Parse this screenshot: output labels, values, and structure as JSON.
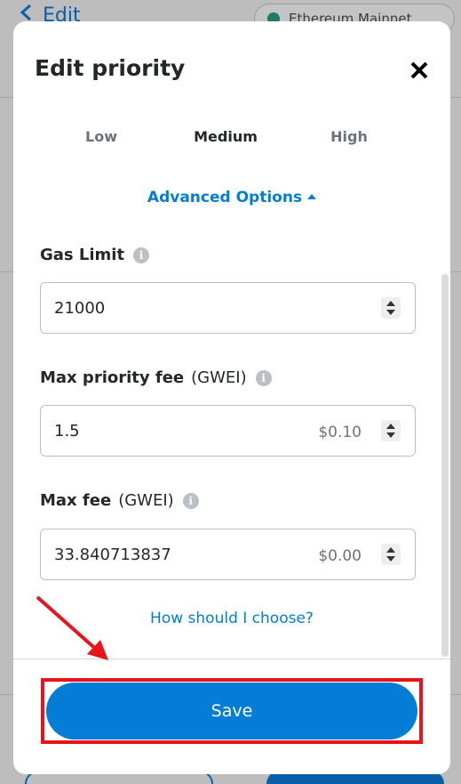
{
  "background": {
    "back_label": "Edit",
    "network_label": "Ethereum Mainnet"
  },
  "modal": {
    "title": "Edit priority",
    "tabs": [
      {
        "label": "Low"
      },
      {
        "label": "Medium",
        "selected": true
      },
      {
        "label": "High"
      }
    ],
    "advanced_label": "Advanced Options",
    "fields": {
      "gas_limit": {
        "label": "Gas Limit",
        "value": "21000"
      },
      "max_priority_fee": {
        "label": "Max priority fee",
        "unit": "(GWEI)",
        "value": "1.5",
        "fiat": "$0.10"
      },
      "max_fee": {
        "label": "Max fee",
        "unit": "(GWEI)",
        "value": "33.840713837",
        "fiat": "$0.00"
      }
    },
    "help_link": "How should I choose?",
    "save_label": "Save"
  },
  "colors": {
    "accent": "#037dd6",
    "highlight": "#e8141c",
    "text": "#24272a",
    "muted": "#6a737d"
  },
  "icons": [
    "back-chevron-icon",
    "network-dot-icon",
    "close-icon",
    "info-icon",
    "caret-up-icon",
    "stepper-icon",
    "annotation-arrow-icon"
  ]
}
